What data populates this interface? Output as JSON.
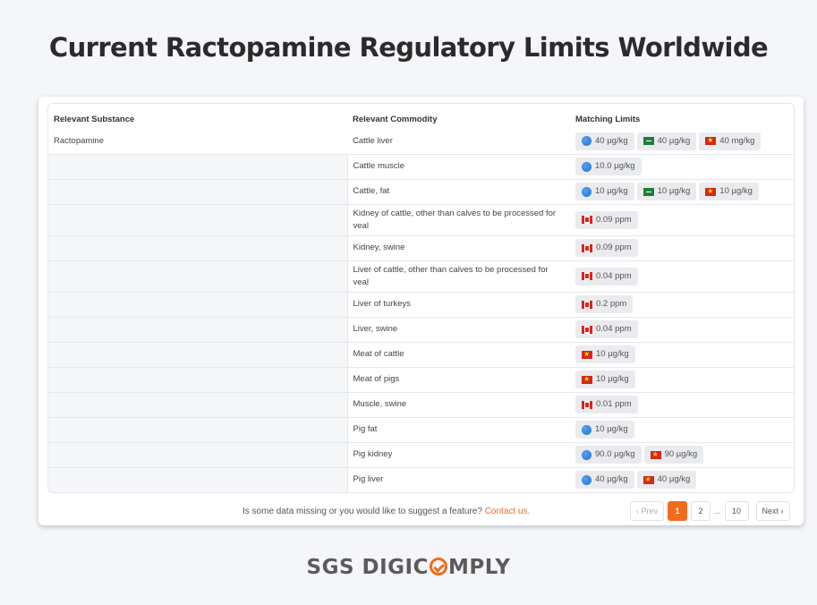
{
  "title": "Current Ractopamine Regulatory Limits Worldwide",
  "table": {
    "headers": {
      "substance": "Relevant Substance",
      "commodity": "Relevant Commodity",
      "limits": "Matching Limits"
    },
    "substance": "Ractopamine",
    "rows": [
      {
        "commodity": "Cattle liver",
        "limits": [
          {
            "flag": "globe-icon",
            "value": "40 µg/kg"
          },
          {
            "flag": "saudi-arabia-flag-icon",
            "value": "40 µg/kg"
          },
          {
            "flag": "vietnam-flag-icon",
            "value": "40 mg/kg"
          }
        ]
      },
      {
        "commodity": "Cattle muscle",
        "limits": [
          {
            "flag": "globe-icon",
            "value": "10.0 µg/kg"
          }
        ]
      },
      {
        "commodity": "Cattle, fat",
        "limits": [
          {
            "flag": "globe-icon",
            "value": "10 µg/kg"
          },
          {
            "flag": "saudi-arabia-flag-icon",
            "value": "10 µg/kg"
          },
          {
            "flag": "vietnam-flag-icon",
            "value": "10 µg/kg"
          }
        ]
      },
      {
        "commodity": "Kidney of cattle, other than calves to be processed for veal",
        "limits": [
          {
            "flag": "canada-flag-icon",
            "value": "0.09 ppm"
          }
        ]
      },
      {
        "commodity": "Kidney, swine",
        "limits": [
          {
            "flag": "canada-flag-icon",
            "value": "0.09 ppm"
          }
        ]
      },
      {
        "commodity": "Liver of cattle, other than calves to be processed for veal",
        "limits": [
          {
            "flag": "canada-flag-icon",
            "value": "0.04 ppm"
          }
        ]
      },
      {
        "commodity": "Liver of turkeys",
        "limits": [
          {
            "flag": "canada-flag-icon",
            "value": "0.2 ppm"
          }
        ]
      },
      {
        "commodity": "Liver, swine",
        "limits": [
          {
            "flag": "canada-flag-icon",
            "value": "0.04 ppm"
          }
        ]
      },
      {
        "commodity": "Meat of cattle",
        "limits": [
          {
            "flag": "vietnam-flag-icon",
            "value": "10 µg/kg"
          }
        ]
      },
      {
        "commodity": "Meat of pigs",
        "limits": [
          {
            "flag": "vietnam-flag-icon",
            "value": "10 µg/kg"
          }
        ]
      },
      {
        "commodity": "Muscle, swine",
        "limits": [
          {
            "flag": "canada-flag-icon",
            "value": "0.01 ppm"
          }
        ]
      },
      {
        "commodity": "Pig fat",
        "limits": [
          {
            "flag": "globe-icon",
            "value": "10 µg/kg"
          }
        ]
      },
      {
        "commodity": "Pig kidney",
        "limits": [
          {
            "flag": "globe-icon",
            "value": "90.0 µg/kg"
          },
          {
            "flag": "vietnam-flag-icon",
            "value": "90 µg/kg"
          }
        ]
      },
      {
        "commodity": "Pig liver",
        "limits": [
          {
            "flag": "globe-icon",
            "value": "40 µg/kg"
          },
          {
            "flag": "vietnam-flag-icon",
            "value": "40 µg/kg"
          }
        ]
      }
    ]
  },
  "footer": {
    "message": "Is some data missing or you would like to suggest a feature?",
    "link": "Contact us."
  },
  "pagination": {
    "prev": "‹ Prev",
    "pages": [
      "1",
      "2"
    ],
    "ellipsis": "...",
    "last": "10",
    "next": "Next ›",
    "current": "1"
  },
  "logo": {
    "part1": "SGS DIGIC",
    "part2": "MPLY"
  }
}
